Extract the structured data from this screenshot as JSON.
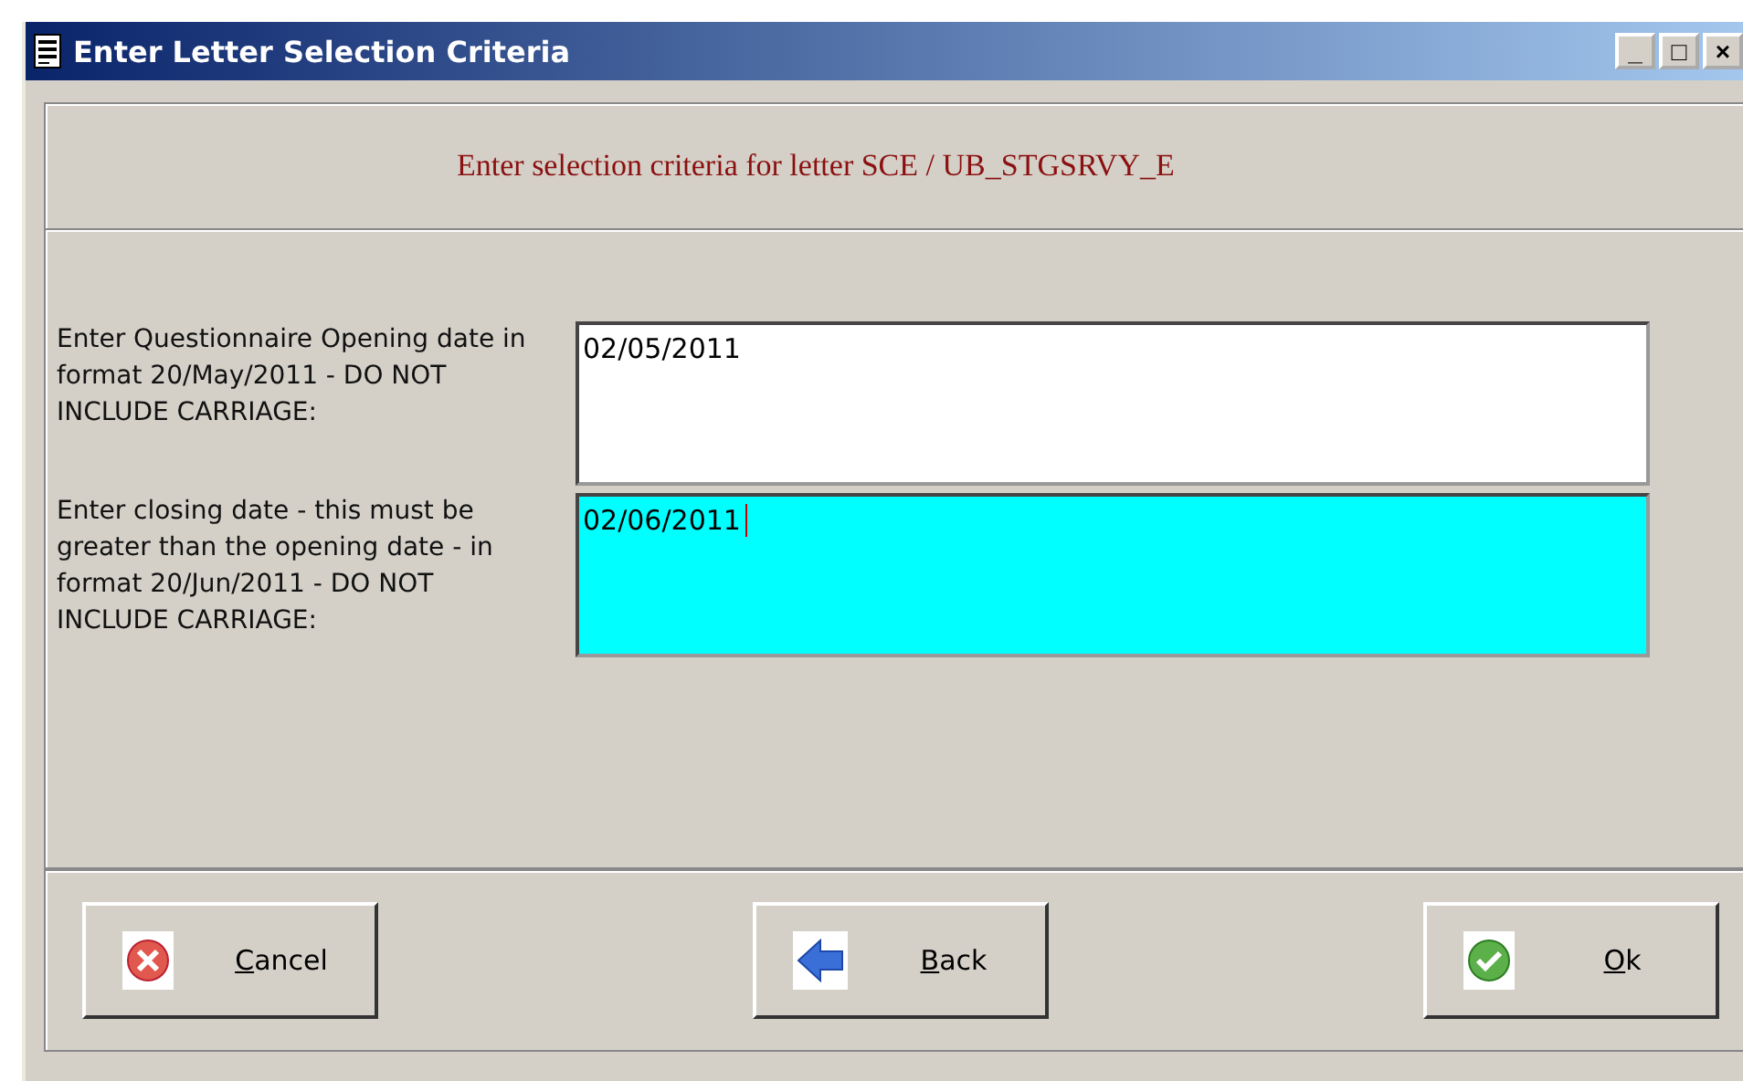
{
  "window": {
    "title": "Enter Letter Selection Criteria",
    "controls": [
      "_",
      "□",
      "×"
    ]
  },
  "heading": "Enter selection criteria for letter SCE / UB_STGSRVY_E",
  "fields": [
    {
      "label": "Enter Questionnaire Opening date in format 20/May/2011 - DO NOT INCLUDE CARRIAGE:",
      "value": "02/05/2011",
      "focused": false
    },
    {
      "label": "Enter closing date - this must be greater than the opening date - in format 20/Jun/2011 - DO NOT INCLUDE CARRIAGE:",
      "value": "02/06/2011",
      "focused": true
    }
  ],
  "buttons": [
    {
      "kind": "cancel",
      "underlined": "C",
      "rest": "ancel"
    },
    {
      "kind": "back",
      "underlined": "B",
      "rest": "ack"
    },
    {
      "kind": "ok",
      "underlined": "O",
      "rest": "k"
    }
  ]
}
